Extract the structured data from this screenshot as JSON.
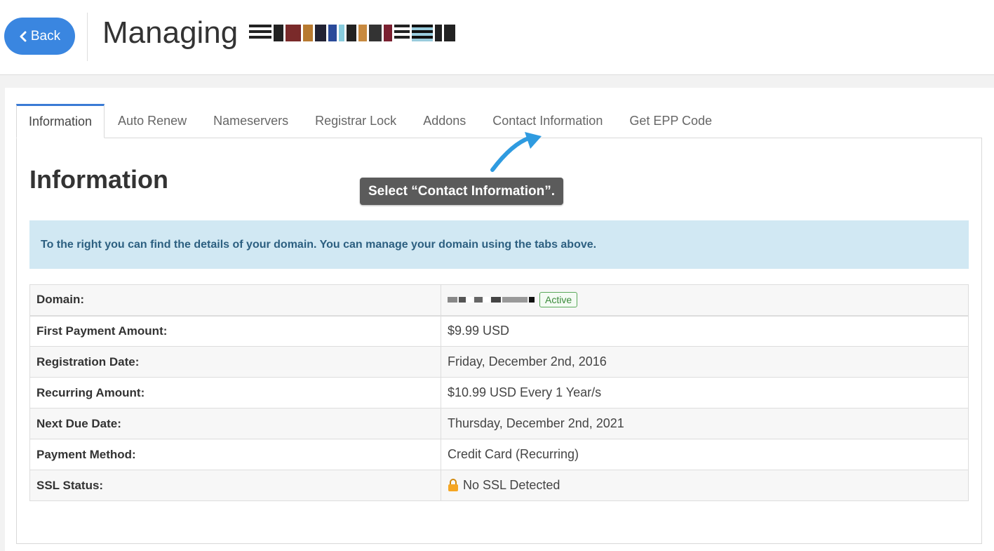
{
  "header": {
    "back_label": "Back",
    "title": "Managing"
  },
  "tabs": [
    {
      "label": "Information",
      "active": true
    },
    {
      "label": "Auto Renew"
    },
    {
      "label": "Nameservers"
    },
    {
      "label": "Registrar Lock"
    },
    {
      "label": "Addons"
    },
    {
      "label": "Contact Information"
    },
    {
      "label": "Get EPP Code"
    }
  ],
  "section": {
    "title": "Information",
    "alert": "To the right you can find the details of your domain. You can manage your domain using the tabs above."
  },
  "details": {
    "domain_label": "Domain:",
    "domain_status": "Active",
    "rows": [
      {
        "label": "First Payment Amount:",
        "value": "$9.99 USD"
      },
      {
        "label": "Registration Date:",
        "value": "Friday, December 2nd, 2016"
      },
      {
        "label": "Recurring Amount:",
        "value": "$10.99 USD Every 1 Year/s"
      },
      {
        "label": "Next Due Date:",
        "value": "Thursday, December 2nd, 2021"
      },
      {
        "label": "Payment Method:",
        "value": "Credit Card (Recurring)"
      },
      {
        "label": "SSL Status:",
        "value": "No SSL Detected"
      }
    ]
  },
  "callout": {
    "text": "Select “Contact Information”."
  },
  "colors": {
    "accent": "#3a86e0",
    "alert_bg": "#d1e8f3",
    "badge_green": "#3a8a3a",
    "callout_bg": "#5b5b5b"
  }
}
